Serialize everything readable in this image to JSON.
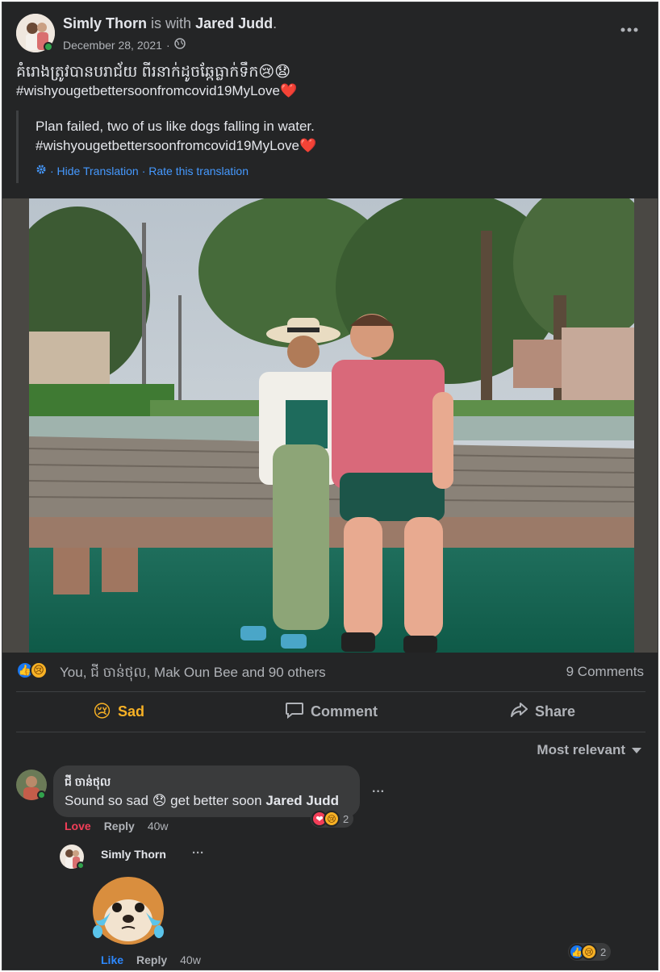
{
  "post": {
    "author": "Simly Thorn",
    "with_text": "is with",
    "tagged": "Jared Judd",
    "tagged_end": ".",
    "date": "December 28, 2021",
    "date_sep": "·",
    "privacy_icon": "globe-icon",
    "more_icon": "more-icon",
    "original_text": "គំរោងត្រូវបានបរាជ័យ ពីរនាក់ដូចឆ្កែធ្លាក់ទឹក😢😧",
    "original_hashtag": "#wishyougetbettersoonfromcovid19MyLove❤️",
    "translation_line1": "Plan failed, two of us like dogs falling in water.",
    "translation_line2": "#wishyougetbettersoonfromcovid19MyLove❤️",
    "hide_translation": "· Hide Translation",
    "rate_translation": "· Rate this translation"
  },
  "reactions": {
    "summary": "You, ជី ចាន់ថុល, Mak Oun Bee and 90 others",
    "comments_count": "9 Comments",
    "icons": [
      "like-icon",
      "sad-icon"
    ]
  },
  "actions": {
    "sad": "Sad",
    "comment": "Comment",
    "share": "Share"
  },
  "sort": {
    "label": "Most relevant"
  },
  "comments": [
    {
      "author": "ជី ចាន់ថុល",
      "text_before": "Sound so sad",
      "text_emoji": "😞",
      "text_after": "get better soon",
      "mention": "Jared Judd",
      "love_label": "Love",
      "reply_label": "Reply",
      "age": "40w",
      "reaction_count": "2",
      "more": "···"
    }
  ],
  "reply": {
    "author": "Simly Thorn",
    "more": "···",
    "like_label": "Like",
    "reply_label": "Reply",
    "age": "40w",
    "reaction_count": "2",
    "sticker": "crying-dog-sticker"
  },
  "colors": {
    "background": "#242526",
    "link": "#4599ff",
    "sad": "#f7b125",
    "love": "#f33e58",
    "online": "#31a24c"
  }
}
